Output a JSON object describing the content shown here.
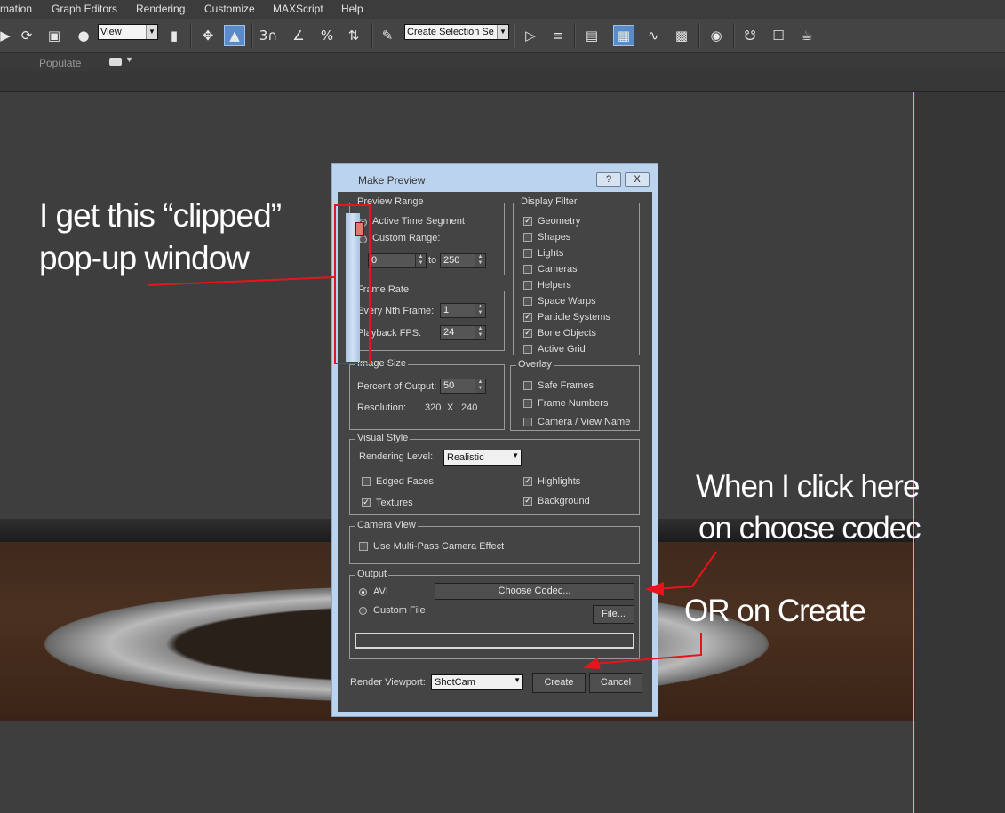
{
  "menu": [
    "mation",
    "Graph Editors",
    "Rendering",
    "Customize",
    "MAXScript",
    "Help"
  ],
  "toolbar": {
    "view_dropdown": "View",
    "selection_set_dropdown": "Create Selection Se",
    "icons": [
      "arrow-right-icon",
      "refresh-icon",
      "scale-icon",
      "sphere-icon",
      "view-icon",
      "mirror-icon",
      "move-icon",
      "highlight-icon",
      "snap-3-icon",
      "angle-snap-icon",
      "percent-snap-icon",
      "spinner-snap-icon",
      "edit-named-sel-icon",
      "mirror-tool-icon",
      "align-icon",
      "layer-icon",
      "toggle-scene-explorer-icon",
      "curve-editor-icon",
      "schematic-icon",
      "material-editor-icon",
      "render-setup-icon",
      "render-frame-icon",
      "teapot-icon"
    ]
  },
  "ribbon": {
    "populate_label": "Populate"
  },
  "dialog": {
    "title": "Make Preview",
    "help_button": "?",
    "close_button": "X",
    "preview_range": {
      "title": "Preview Range",
      "active_time_segment": "Active Time Segment",
      "custom_range": "Custom Range:",
      "from_value": "0",
      "to_label": "to",
      "to_value": "250"
    },
    "frame_rate": {
      "title": "Frame Rate",
      "every_nth_label": "Every Nth Frame:",
      "every_nth_value": "1",
      "playback_fps_label": "Playback FPS:",
      "playback_fps_value": "24"
    },
    "image_size": {
      "title": "Image Size",
      "percent_label": "Percent of Output:",
      "percent_value": "50",
      "resolution_label": "Resolution:",
      "res_w": "320",
      "res_x": "X",
      "res_h": "240"
    },
    "display_filter": {
      "title": "Display Filter",
      "items": [
        {
          "label": "Geometry",
          "checked": true
        },
        {
          "label": "Shapes",
          "checked": false
        },
        {
          "label": "Lights",
          "checked": false
        },
        {
          "label": "Cameras",
          "checked": false
        },
        {
          "label": "Helpers",
          "checked": false
        },
        {
          "label": "Space Warps",
          "checked": false
        },
        {
          "label": "Particle Systems",
          "checked": true
        },
        {
          "label": "Bone Objects",
          "checked": true
        },
        {
          "label": "Active Grid",
          "checked": false
        }
      ]
    },
    "overlay": {
      "title": "Overlay",
      "items": [
        {
          "label": "Safe Frames",
          "checked": false
        },
        {
          "label": "Frame Numbers",
          "checked": false
        },
        {
          "label": "Camera / View Name",
          "checked": false
        }
      ]
    },
    "visual_style": {
      "title": "Visual Style",
      "rendering_level_label": "Rendering Level:",
      "rendering_level_value": "Realistic",
      "edged_faces": "Edged Faces",
      "textures": "Textures",
      "highlights": "Highlights",
      "background": "Background"
    },
    "camera_view": {
      "title": "Camera View",
      "multipass": "Use Multi-Pass Camera Effect"
    },
    "output": {
      "title": "Output",
      "avi": "AVI",
      "custom_file": "Custom File",
      "choose_codec": "Choose Codec...",
      "file_button": "File..."
    },
    "render_viewport_label": "Render Viewport:",
    "render_viewport_value": "ShotCam",
    "create_button": "Create",
    "cancel_button": "Cancel"
  },
  "annotations": {
    "left_line1": "I get this “clipped”",
    "left_line2": "pop-up window",
    "right_line1": "When I click here",
    "right_line2": "on choose codec",
    "right_line3": "OR on Create"
  },
  "colors": {
    "annotation_red": "#e8141b",
    "viewport_border": "#d8c22a",
    "dialog_frame": "#bcd3ee"
  }
}
